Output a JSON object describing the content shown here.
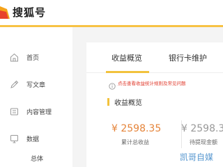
{
  "header": {
    "brand": "搜狐号"
  },
  "sidebar": {
    "items": [
      {
        "label": "首页",
        "icon": "home-icon"
      },
      {
        "label": "写文章",
        "icon": "pencil-icon"
      },
      {
        "label": "内容管理",
        "icon": "content-icon"
      },
      {
        "label": "数据",
        "icon": "data-icon"
      }
    ],
    "sub_items": [
      {
        "label": "总体"
      }
    ]
  },
  "main": {
    "tabs": [
      {
        "label": "收益概览",
        "active": true
      },
      {
        "label": "银行卡维护",
        "active": false
      }
    ],
    "notice": "点击查看收益统计规则及常见问题",
    "section_title": "收益概览",
    "stats": [
      {
        "value": "¥ 2598.35",
        "label": "累计总收益"
      },
      {
        "value": "¥ 2598.3",
        "label": "待提现金额"
      }
    ]
  },
  "watermark": "凯哥自媒",
  "colors": {
    "accent": "#f2c23c",
    "money": "#e5843a",
    "notice": "#e0392b",
    "watermark": "#3d87c8"
  }
}
